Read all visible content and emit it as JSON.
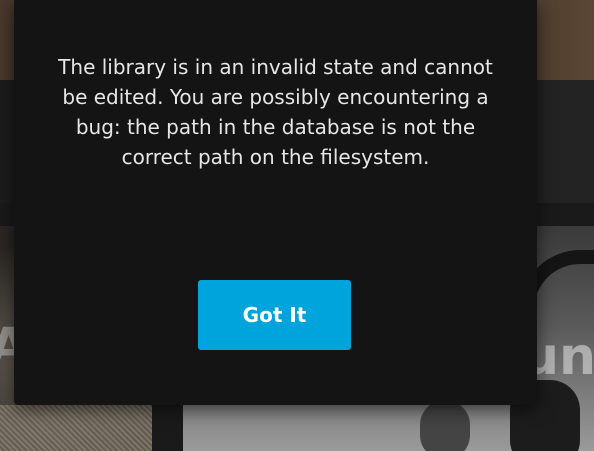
{
  "background": {
    "left_thumbnail_text": "A",
    "right_thumbnail_text": "un"
  },
  "dialog": {
    "message": "The library is in an invalid state and cannot be edited. You are possibly encountering a bug: the path in the database is not the correct path on the filesystem.",
    "confirm_label": "Got It",
    "accent_color": "#00a4dc"
  }
}
